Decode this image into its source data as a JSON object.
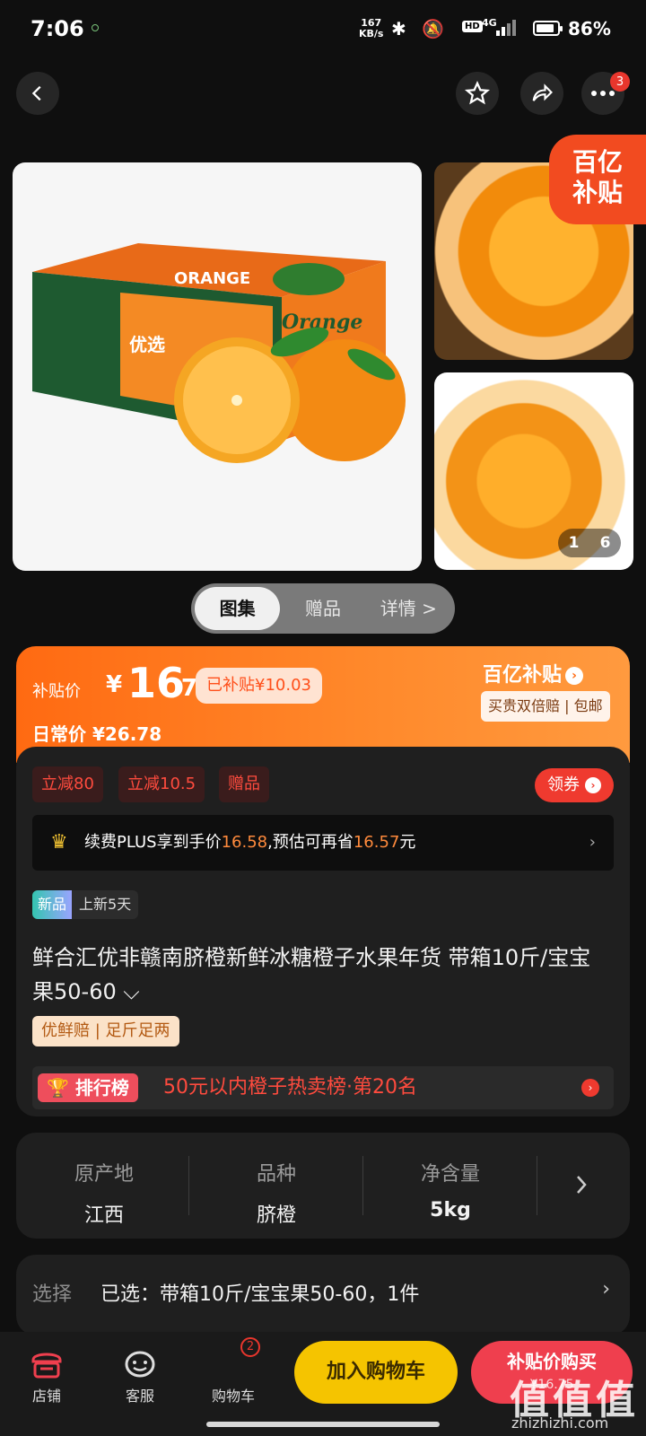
{
  "status": {
    "time": "7:06",
    "net_speed": "167",
    "net_unit": "KB/s",
    "hd": "HD",
    "signal": "4G",
    "battery_pct": 86,
    "battery_text": "86%"
  },
  "nav": {
    "more_badge": "3"
  },
  "gallery": {
    "yi_line1": "百亿",
    "yi_line2": "补贴",
    "box_text1": "ORANGE",
    "box_text2": "优选",
    "box_text3": "Orange",
    "counter_current": "1",
    "counter_total": "6",
    "tabs": [
      {
        "label": "图集",
        "active": true
      },
      {
        "label": "赠品",
        "active": false
      },
      {
        "label": "详情 >",
        "active": false
      }
    ]
  },
  "price": {
    "label": "补贴价",
    "currency": "¥",
    "integer": "16",
    "fraction": ".75",
    "subsidized": "已补贴¥10.03",
    "regular": "日常价 ¥26.78",
    "brand": "百亿补贴",
    "brand_tags": "买贵双倍赔 | 包邮"
  },
  "promo": {
    "chips": [
      "立减80",
      "立减10.5",
      "赠品"
    ],
    "coupon": "领券",
    "plus_pre": "续费PLUS享到手价",
    "plus_price": "16.58",
    "plus_mid": ",预估可再省",
    "plus_save": "16.57",
    "plus_post": "元",
    "new_tag": "新品",
    "new_days": "上新5天",
    "title": "鲜合汇优非赣南脐橙新鲜冰糖橙子水果年货 带箱10斤/宝宝果50-60 ⌵",
    "features": "优鲜赔 | 足斤足两",
    "rank_badge": "排行榜",
    "rank_text": "50元以内橙子热卖榜·第20名"
  },
  "specs": [
    {
      "key": "原产地",
      "value": "江西"
    },
    {
      "key": "品种",
      "value": "脐橙"
    },
    {
      "key": "净含量",
      "value": "5kg"
    }
  ],
  "selection": {
    "key": "选择",
    "value": "已选：带箱10斤/宝宝果50-60，1件"
  },
  "bottom": {
    "shop": "店铺",
    "service": "客服",
    "cart": "购物车",
    "cart_badge": "2",
    "add_cart": "加入购物车",
    "buy_now": "补贴价购买",
    "buy_sub": "¥16.75"
  },
  "watermark": {
    "big": "值值值",
    "small": "zhizhizhi.com"
  }
}
